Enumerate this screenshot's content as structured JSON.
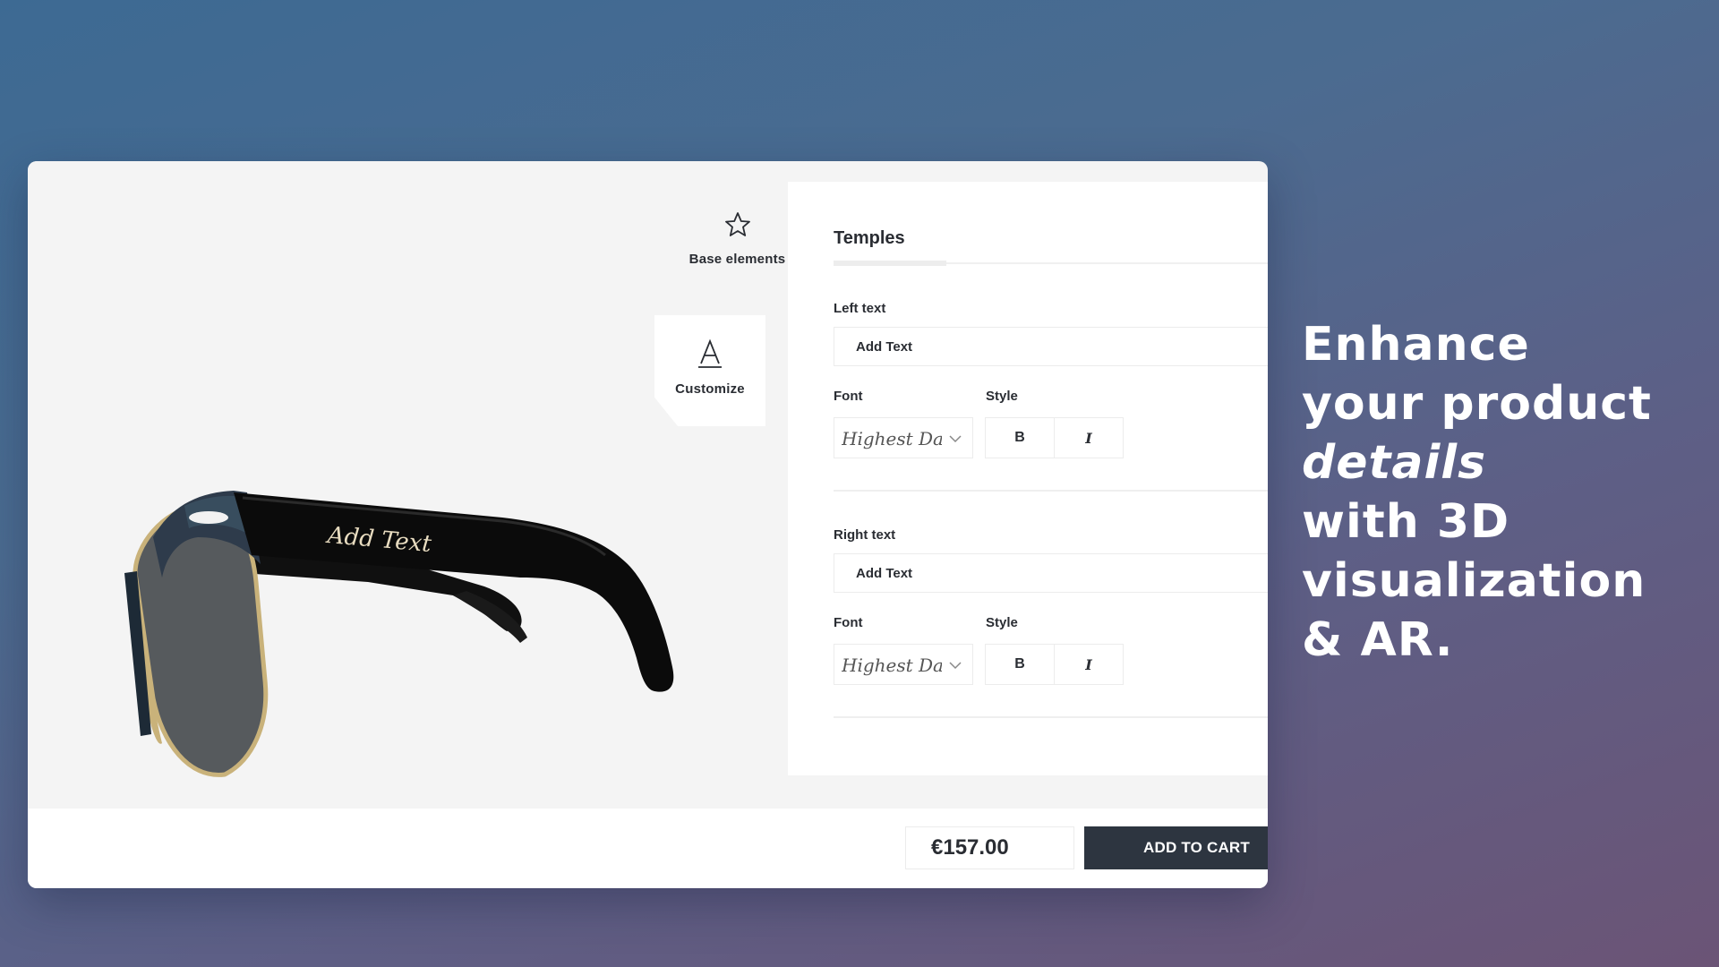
{
  "toolbar": {
    "base_label": "Base elements",
    "customize_label": "Customize"
  },
  "preview": {
    "engraving": "Add Text"
  },
  "panel": {
    "title": "Temples",
    "left": {
      "label": "Left text",
      "value": "Add Text",
      "font_label": "Font",
      "font_value": "Highest Daf",
      "style_label": "Style",
      "bold": "B",
      "italic": "I"
    },
    "right": {
      "label": "Right text",
      "value": "Add Text",
      "font_label": "Font",
      "font_value": "Highest Daf",
      "style_label": "Style",
      "bold": "B",
      "italic": "I"
    }
  },
  "footer": {
    "price": "€157.00",
    "cart_label": "ADD TO CART"
  },
  "headline": {
    "line1": "Enhance",
    "line2": "your product",
    "line3": "details",
    "line4": "with 3D",
    "line5": "visualization",
    "line6": "& AR."
  },
  "icons": {
    "base": "star-icon",
    "customize": "letter-a-icon",
    "dropdown": "chevron-down-icon"
  },
  "colors": {
    "cart_button": "#2d3540",
    "frame": "#0b0b0b",
    "rim": "#c9b27a"
  }
}
